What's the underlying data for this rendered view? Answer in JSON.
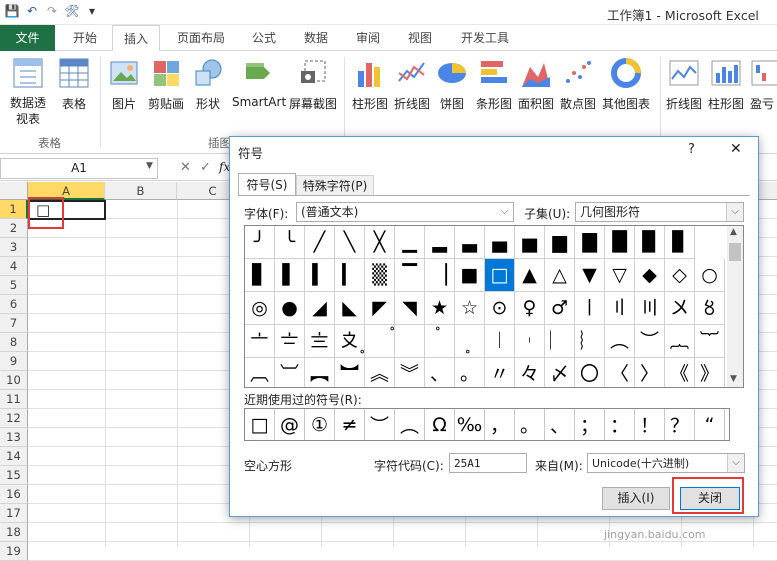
{
  "window": {
    "title": "工作簿1 - Microsoft Excel"
  },
  "qat": {
    "save": "💾",
    "undo": "↶",
    "redo": "↷",
    "tools": "🛠",
    "more": "▾"
  },
  "tabs": [
    "文件",
    "开始",
    "插入",
    "页面布局",
    "公式",
    "数据",
    "审阅",
    "视图",
    "开发工具"
  ],
  "active_tab": "插入",
  "ribbon": {
    "buttons": [
      "数据透视表",
      "表格",
      "图片",
      "剪贴画",
      "形状",
      "SmartArt",
      "屏幕截图",
      "柱形图",
      "折线图",
      "饼图",
      "条形图",
      "面积图",
      "散点图",
      "其他图表",
      "折线图",
      "柱形图",
      "盈亏"
    ],
    "groups": [
      "表格",
      "插图"
    ]
  },
  "formula_bar": {
    "name_box": "A1",
    "fx": "fx"
  },
  "sheet": {
    "columns": [
      "A",
      "B",
      "C"
    ],
    "rows": [
      "1",
      "2",
      "3",
      "4",
      "5",
      "6",
      "7",
      "8",
      "9",
      "10",
      "11",
      "12",
      "13",
      "14",
      "15",
      "16",
      "17",
      "18",
      "19"
    ],
    "a1_value": "□"
  },
  "dialog": {
    "title": "符号",
    "help": "?",
    "close": "✕",
    "tabs": [
      "符号(S)",
      "特殊字符(P)"
    ],
    "font_label": "字体(F):",
    "font_value": "(普通文本)",
    "subset_label": "子集(U):",
    "subset_value": "几何图形符",
    "grid_rows": [
      [
        "╯",
        "╰",
        "╱",
        "╲",
        "╳",
        "▁",
        "▂",
        "▃",
        "▄",
        "▅",
        "▆",
        "▇",
        "█",
        "▉",
        "▊"
      ],
      [
        "▋",
        "▌",
        "▍",
        "▎",
        "▒",
        "▔",
        "▕",
        "■",
        "□",
        "▲",
        "△",
        "▼",
        "▽",
        "◆",
        "◇",
        "○"
      ],
      [
        "◎",
        "●",
        "◢",
        "◣",
        "◤",
        "◥",
        "★",
        "☆",
        "⊙",
        "♀",
        "♂",
        "〡",
        "〢",
        "〣",
        "〤",
        "〥"
      ],
      [
        "〦",
        "〧",
        "〨",
        "〩",
        "〪",
        "〫",
        "〬",
        "〭",
        "︱",
        "︲",
        "︳",
        "︴",
        "︵",
        "︶",
        "︷",
        "︸"
      ],
      [
        "︹",
        "︺",
        "︻",
        "︼",
        "︽",
        "︾",
        "、",
        "。",
        "〃",
        "々",
        "〆",
        "〇",
        "〈",
        "〉",
        "《",
        "》"
      ]
    ],
    "recent_label": "近期使用过的符号(R):",
    "recent": [
      "□",
      "@",
      "①",
      "≠",
      "︶",
      "︵",
      "Ω",
      "‰",
      "，",
      "。",
      "、",
      "；",
      "：",
      "！",
      "？",
      "“"
    ],
    "char_name": "空心方形",
    "code_label": "字符代码(C):",
    "code_value": "25A1",
    "from_label": "来自(M):",
    "from_value": "Unicode(十六进制)",
    "insert_button": "插入(I)",
    "close_button": "关闭"
  },
  "watermark": "jingyan.baidu.com",
  "colors": {
    "excel_green": "#1e7145",
    "highlight_red": "#e53935",
    "selection_blue": "#0078d7"
  }
}
